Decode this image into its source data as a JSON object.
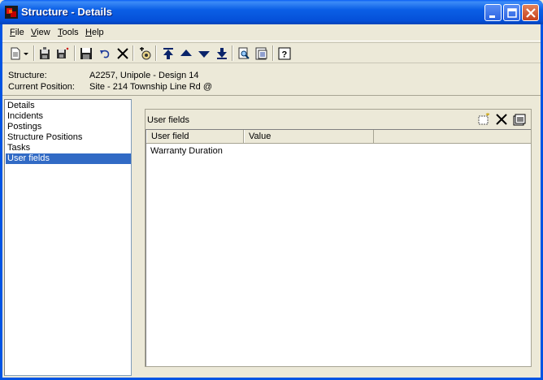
{
  "window": {
    "title": "Structure - Details",
    "controls": {
      "minimize": "minimize-icon",
      "maximize": "maximize-icon",
      "close": "close-icon"
    }
  },
  "menu": {
    "items": [
      {
        "label": "File",
        "accel": "F",
        "rest": "ile"
      },
      {
        "label": "View",
        "accel": "V",
        "rest": "iew"
      },
      {
        "label": "Tools",
        "accel": "T",
        "rest": "ools"
      },
      {
        "label": "Help",
        "accel": "H",
        "rest": "elp"
      }
    ]
  },
  "toolbar": {
    "icons": [
      "new-document-icon",
      "dropdown-arrow-icon",
      "save-copy-icon",
      "save-new-icon",
      "save-icon",
      "undo-icon",
      "delete-icon",
      "attach-icon",
      "move-first-icon",
      "move-up-icon",
      "move-down-icon",
      "move-last-icon",
      "find-icon",
      "report-icon",
      "help-icon"
    ]
  },
  "info": {
    "structure_label": "Structure:",
    "structure_value": "A2257, Unipole - Design 14",
    "position_label": "Current Position:",
    "position_value": "Site - 214 Township Line Rd @"
  },
  "nav": {
    "items": [
      "Details",
      "Incidents",
      "Postings",
      "Structure Positions",
      "Tasks",
      "User fields"
    ],
    "selected": "User fields"
  },
  "panel": {
    "title": "User fields",
    "tools": [
      "new-row-icon",
      "delete-row-icon",
      "properties-icon"
    ],
    "columns": [
      "User field",
      "Value"
    ],
    "rows": [
      {
        "user_field": "Warranty Duration",
        "value": ""
      }
    ]
  },
  "colors": {
    "titlebar": "#0054e3",
    "selection": "#316ac5",
    "face": "#ece9d8"
  }
}
